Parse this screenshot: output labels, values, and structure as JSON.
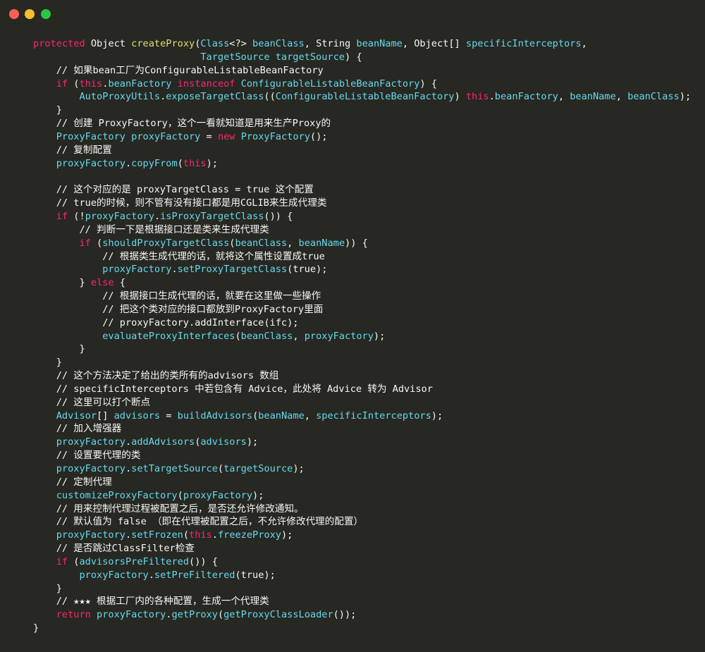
{
  "window": {
    "buttons": [
      {
        "name": "close",
        "color": "#ff5f57"
      },
      {
        "name": "minimize",
        "color": "#febc2e"
      },
      {
        "name": "zoom",
        "color": "#28c840"
      }
    ]
  },
  "theme": {
    "background": "#272822",
    "plain": "#f8f8f2",
    "keyword": "#f92672",
    "function_def": "#e6db74",
    "identifier": "#66d9ef",
    "comment": "#f8f8f2"
  },
  "code_lines": [
    [
      {
        "t": "protected",
        "k": "kw"
      },
      {
        "t": " Object ",
        "k": "pl"
      },
      {
        "t": "createProxy",
        "k": "fn"
      },
      {
        "t": "(",
        "k": "pl"
      },
      {
        "t": "Class",
        "k": "ty"
      },
      {
        "t": "<?> ",
        "k": "pl"
      },
      {
        "t": "beanClass",
        "k": "ty"
      },
      {
        "t": ", String ",
        "k": "pl"
      },
      {
        "t": "beanName",
        "k": "ty"
      },
      {
        "t": ", Object[] ",
        "k": "pl"
      },
      {
        "t": "specificInterceptors",
        "k": "ty"
      },
      {
        "t": ",",
        "k": "pl"
      }
    ],
    [
      {
        "t": "                             ",
        "k": "pl"
      },
      {
        "t": "TargetSource",
        "k": "ty"
      },
      {
        "t": " ",
        "k": "pl"
      },
      {
        "t": "targetSource",
        "k": "ty"
      },
      {
        "t": ") {",
        "k": "pl"
      }
    ],
    [
      {
        "t": "    // 如果bean工厂为ConfigurableListableBeanFactory",
        "k": "cm"
      }
    ],
    [
      {
        "t": "    ",
        "k": "pl"
      },
      {
        "t": "if",
        "k": "kw"
      },
      {
        "t": " (",
        "k": "pl"
      },
      {
        "t": "this",
        "k": "kw"
      },
      {
        "t": ".",
        "k": "pl"
      },
      {
        "t": "beanFactory",
        "k": "ty"
      },
      {
        "t": " ",
        "k": "pl"
      },
      {
        "t": "instanceof",
        "k": "kw"
      },
      {
        "t": " ",
        "k": "pl"
      },
      {
        "t": "ConfigurableListableBeanFactory",
        "k": "ty"
      },
      {
        "t": ") {",
        "k": "pl"
      }
    ],
    [
      {
        "t": "        ",
        "k": "pl"
      },
      {
        "t": "AutoProxyUtils",
        "k": "ty"
      },
      {
        "t": ".",
        "k": "pl"
      },
      {
        "t": "exposeTargetClass",
        "k": "ty"
      },
      {
        "t": "((",
        "k": "pl"
      },
      {
        "t": "ConfigurableListableBeanFactory",
        "k": "ty"
      },
      {
        "t": ") ",
        "k": "pl"
      },
      {
        "t": "this",
        "k": "kw"
      },
      {
        "t": ".",
        "k": "pl"
      },
      {
        "t": "beanFactory",
        "k": "ty"
      },
      {
        "t": ", ",
        "k": "pl"
      },
      {
        "t": "beanName",
        "k": "ty"
      },
      {
        "t": ", ",
        "k": "pl"
      },
      {
        "t": "beanClass",
        "k": "ty"
      },
      {
        "t": ");",
        "k": "pl"
      }
    ],
    [
      {
        "t": "    }",
        "k": "pl"
      }
    ],
    [
      {
        "t": "    // 创建 ProxyFactory，这个一看就知道是用来生产Proxy的",
        "k": "cm"
      }
    ],
    [
      {
        "t": "    ",
        "k": "pl"
      },
      {
        "t": "ProxyFactory",
        "k": "ty"
      },
      {
        "t": " ",
        "k": "pl"
      },
      {
        "t": "proxyFactory",
        "k": "ty"
      },
      {
        "t": " = ",
        "k": "pl"
      },
      {
        "t": "new",
        "k": "kw"
      },
      {
        "t": " ",
        "k": "pl"
      },
      {
        "t": "ProxyFactory",
        "k": "ty"
      },
      {
        "t": "();",
        "k": "pl"
      }
    ],
    [
      {
        "t": "    // 复制配置",
        "k": "cm"
      }
    ],
    [
      {
        "t": "    ",
        "k": "pl"
      },
      {
        "t": "proxyFactory",
        "k": "ty"
      },
      {
        "t": ".",
        "k": "pl"
      },
      {
        "t": "copyFrom",
        "k": "ty"
      },
      {
        "t": "(",
        "k": "pl"
      },
      {
        "t": "this",
        "k": "kw"
      },
      {
        "t": ");",
        "k": "pl"
      }
    ],
    [
      {
        "t": "",
        "k": "pl"
      }
    ],
    [
      {
        "t": "    // 这个对应的是 proxyTargetClass = true 这个配置",
        "k": "cm"
      }
    ],
    [
      {
        "t": "    // true的时候，则不管有没有接口都是用CGLIB来生成代理类",
        "k": "cm"
      }
    ],
    [
      {
        "t": "    ",
        "k": "pl"
      },
      {
        "t": "if",
        "k": "kw"
      },
      {
        "t": " (!",
        "k": "pl"
      },
      {
        "t": "proxyFactory",
        "k": "ty"
      },
      {
        "t": ".",
        "k": "pl"
      },
      {
        "t": "isProxyTargetClass",
        "k": "ty"
      },
      {
        "t": "()) {",
        "k": "pl"
      }
    ],
    [
      {
        "t": "        // 判断一下是根据接口还是类来生成代理类",
        "k": "cm"
      }
    ],
    [
      {
        "t": "        ",
        "k": "pl"
      },
      {
        "t": "if",
        "k": "kw"
      },
      {
        "t": " (",
        "k": "pl"
      },
      {
        "t": "shouldProxyTargetClass",
        "k": "ty"
      },
      {
        "t": "(",
        "k": "pl"
      },
      {
        "t": "beanClass",
        "k": "ty"
      },
      {
        "t": ", ",
        "k": "pl"
      },
      {
        "t": "beanName",
        "k": "ty"
      },
      {
        "t": ")) {",
        "k": "pl"
      }
    ],
    [
      {
        "t": "            // 根据类生成代理的话，就将这个属性设置成true",
        "k": "cm"
      }
    ],
    [
      {
        "t": "            ",
        "k": "pl"
      },
      {
        "t": "proxyFactory",
        "k": "ty"
      },
      {
        "t": ".",
        "k": "pl"
      },
      {
        "t": "setProxyTargetClass",
        "k": "ty"
      },
      {
        "t": "(true);",
        "k": "pl"
      }
    ],
    [
      {
        "t": "        } ",
        "k": "pl"
      },
      {
        "t": "else",
        "k": "kw"
      },
      {
        "t": " {",
        "k": "pl"
      }
    ],
    [
      {
        "t": "            // 根据接口生成代理的话，就要在这里做一些操作",
        "k": "cm"
      }
    ],
    [
      {
        "t": "            // 把这个类对应的接口都放到ProxyFactory里面",
        "k": "cm"
      }
    ],
    [
      {
        "t": "            // proxyFactory.addInterface(ifc);",
        "k": "cm"
      }
    ],
    [
      {
        "t": "            ",
        "k": "pl"
      },
      {
        "t": "evaluateProxyInterfaces",
        "k": "ty"
      },
      {
        "t": "(",
        "k": "pl"
      },
      {
        "t": "beanClass",
        "k": "ty"
      },
      {
        "t": ", ",
        "k": "pl"
      },
      {
        "t": "proxyFactory",
        "k": "ty"
      },
      {
        "t": ");",
        "k": "pl"
      }
    ],
    [
      {
        "t": "        }",
        "k": "pl"
      }
    ],
    [
      {
        "t": "    }",
        "k": "pl"
      }
    ],
    [
      {
        "t": "    // 这个方法决定了给出的类所有的advisors 数组",
        "k": "cm"
      }
    ],
    [
      {
        "t": "    // specificInterceptors 中若包含有 Advice，此处将 Advice 转为 Advisor",
        "k": "cm"
      }
    ],
    [
      {
        "t": "    // 这里可以打个断点",
        "k": "cm"
      }
    ],
    [
      {
        "t": "    ",
        "k": "pl"
      },
      {
        "t": "Advisor",
        "k": "ty"
      },
      {
        "t": "[] ",
        "k": "pl"
      },
      {
        "t": "advisors",
        "k": "ty"
      },
      {
        "t": " = ",
        "k": "pl"
      },
      {
        "t": "buildAdvisors",
        "k": "ty"
      },
      {
        "t": "(",
        "k": "pl"
      },
      {
        "t": "beanName",
        "k": "ty"
      },
      {
        "t": ", ",
        "k": "pl"
      },
      {
        "t": "specificInterceptors",
        "k": "ty"
      },
      {
        "t": ");",
        "k": "pl"
      }
    ],
    [
      {
        "t": "    // 加入增强器",
        "k": "cm"
      }
    ],
    [
      {
        "t": "    ",
        "k": "pl"
      },
      {
        "t": "proxyFactory",
        "k": "ty"
      },
      {
        "t": ".",
        "k": "pl"
      },
      {
        "t": "addAdvisors",
        "k": "ty"
      },
      {
        "t": "(",
        "k": "pl"
      },
      {
        "t": "advisors",
        "k": "ty"
      },
      {
        "t": ");",
        "k": "pl"
      }
    ],
    [
      {
        "t": "    // 设置要代理的类",
        "k": "cm"
      }
    ],
    [
      {
        "t": "    ",
        "k": "pl"
      },
      {
        "t": "proxyFactory",
        "k": "ty"
      },
      {
        "t": ".",
        "k": "pl"
      },
      {
        "t": "setTargetSource",
        "k": "ty"
      },
      {
        "t": "(",
        "k": "pl"
      },
      {
        "t": "targetSource",
        "k": "ty"
      },
      {
        "t": ");",
        "k": "pl"
      }
    ],
    [
      {
        "t": "    // 定制代理",
        "k": "cm"
      }
    ],
    [
      {
        "t": "    ",
        "k": "pl"
      },
      {
        "t": "customizeProxyFactory",
        "k": "ty"
      },
      {
        "t": "(",
        "k": "pl"
      },
      {
        "t": "proxyFactory",
        "k": "ty"
      },
      {
        "t": ");",
        "k": "pl"
      }
    ],
    [
      {
        "t": "    // 用来控制代理过程被配置之后，是否还允许修改通知。",
        "k": "cm"
      }
    ],
    [
      {
        "t": "    // 默认值为 false （即在代理被配置之后，不允许修改代理的配置）",
        "k": "cm"
      }
    ],
    [
      {
        "t": "    ",
        "k": "pl"
      },
      {
        "t": "proxyFactory",
        "k": "ty"
      },
      {
        "t": ".",
        "k": "pl"
      },
      {
        "t": "setFrozen",
        "k": "ty"
      },
      {
        "t": "(",
        "k": "pl"
      },
      {
        "t": "this",
        "k": "kw"
      },
      {
        "t": ".",
        "k": "pl"
      },
      {
        "t": "freezeProxy",
        "k": "ty"
      },
      {
        "t": ");",
        "k": "pl"
      }
    ],
    [
      {
        "t": "    // 是否跳过ClassFilter检查",
        "k": "cm"
      }
    ],
    [
      {
        "t": "    ",
        "k": "pl"
      },
      {
        "t": "if",
        "k": "kw"
      },
      {
        "t": " (",
        "k": "pl"
      },
      {
        "t": "advisorsPreFiltered",
        "k": "ty"
      },
      {
        "t": "()) {",
        "k": "pl"
      }
    ],
    [
      {
        "t": "        ",
        "k": "pl"
      },
      {
        "t": "proxyFactory",
        "k": "ty"
      },
      {
        "t": ".",
        "k": "pl"
      },
      {
        "t": "setPreFiltered",
        "k": "ty"
      },
      {
        "t": "(true);",
        "k": "pl"
      }
    ],
    [
      {
        "t": "    }",
        "k": "pl"
      }
    ],
    [
      {
        "t": "    // ★★★ 根据工厂内的各种配置，生成一个代理类",
        "k": "cm"
      }
    ],
    [
      {
        "t": "    ",
        "k": "pl"
      },
      {
        "t": "return",
        "k": "kw"
      },
      {
        "t": " ",
        "k": "pl"
      },
      {
        "t": "proxyFactory",
        "k": "ty"
      },
      {
        "t": ".",
        "k": "pl"
      },
      {
        "t": "getProxy",
        "k": "ty"
      },
      {
        "t": "(",
        "k": "pl"
      },
      {
        "t": "getProxyClassLoader",
        "k": "ty"
      },
      {
        "t": "());",
        "k": "pl"
      }
    ],
    [
      {
        "t": "}",
        "k": "pl"
      }
    ]
  ]
}
